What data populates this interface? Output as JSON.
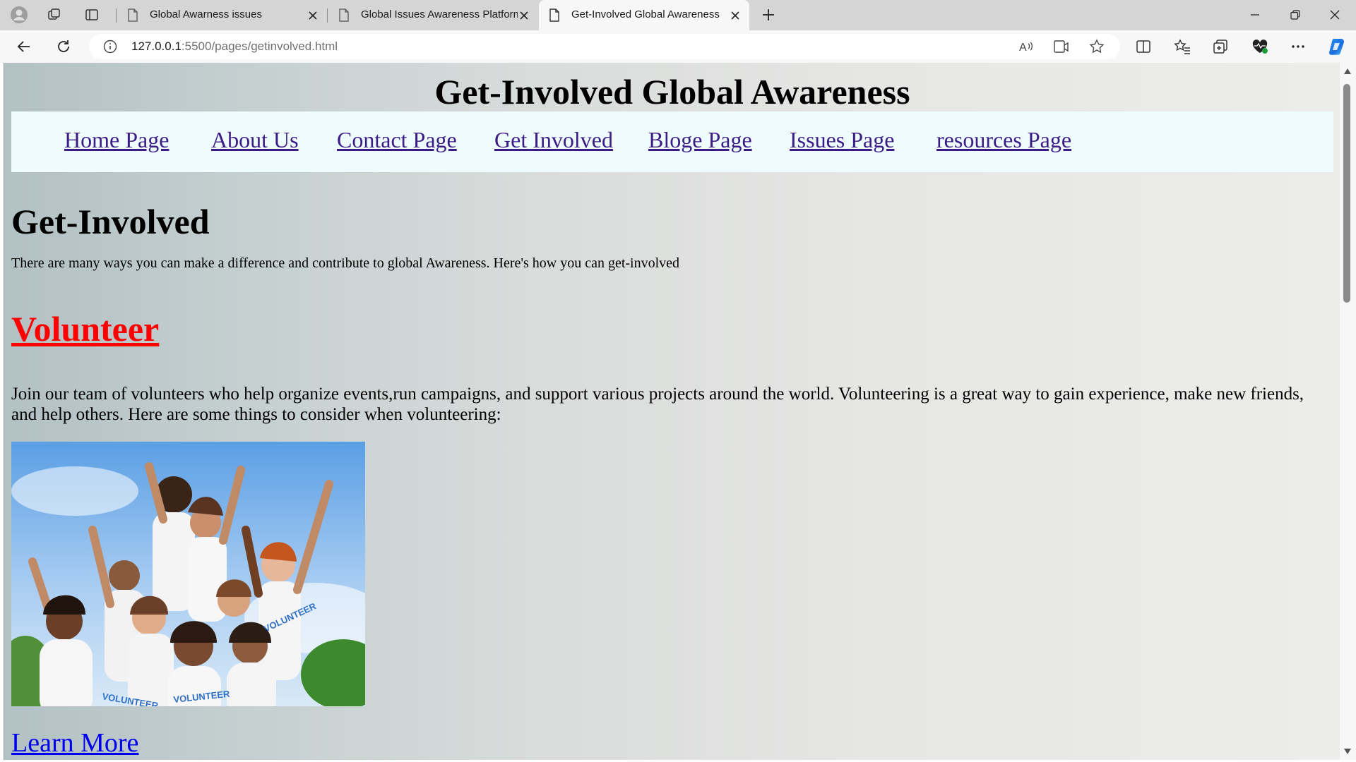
{
  "browser": {
    "tabs": [
      {
        "title": "Global Awarness issues",
        "active": false
      },
      {
        "title": "Global Issues Awareness Platform",
        "active": false
      },
      {
        "title": "Get-Involved Global Awareness",
        "active": true
      }
    ],
    "address": {
      "host": "127.0.0.1",
      "rest": ":5500/pages/getinvolved.html"
    },
    "accent_color": "#1a73e8"
  },
  "site": {
    "title": "Get-Involved Global Awareness",
    "nav": [
      "Home Page",
      "About Us",
      "Contact Page",
      "Get Involved",
      "Bloge Page",
      "Issues Page",
      "resources Page"
    ]
  },
  "main": {
    "heading": "Get-Involved",
    "intro": "There are many ways you can make a difference and contribute to global Awareness. Here's how you can get-involved",
    "volunteer": {
      "heading": "Volunteer",
      "text": "Join our team of volunteers who help organize events,run campaigns, and support various projects around the world. Volunteering is a great way to gain experience, make new friends, and help others. Here are some things to consider when volunteering:",
      "image_alt": "group of cheering volunteers",
      "learn_more": "Learn More"
    }
  },
  "colors": {
    "nav_link": "#3b1b86",
    "volunteer_heading": "#ff0000",
    "learn_more": "#0000ee",
    "nav_background": "#effcfe"
  }
}
